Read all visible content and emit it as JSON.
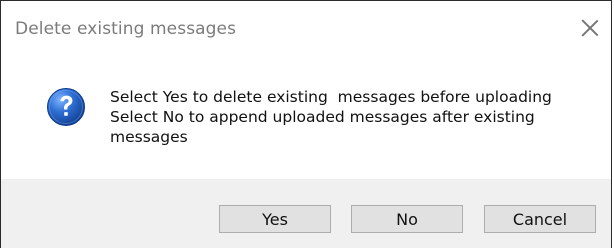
{
  "dialog": {
    "title": "Delete existing messages",
    "message": "Select Yes to delete existing  messages before uploading\nSelect No to append uploaded messages after existing\nmessages",
    "icon": "question-icon",
    "buttons": {
      "yes": "Yes",
      "no": "No",
      "cancel": "Cancel"
    }
  }
}
